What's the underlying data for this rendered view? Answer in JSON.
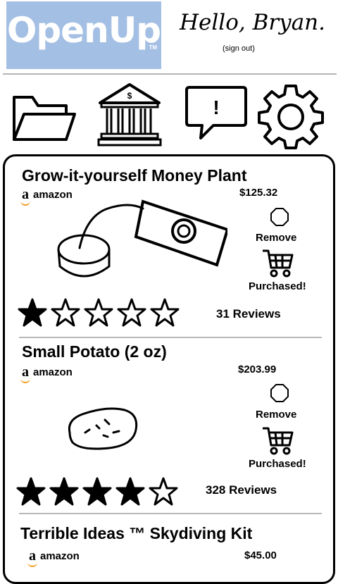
{
  "header": {
    "logo_text": "OpenUp",
    "logo_tm": "TM",
    "greeting": "Hello, Bryan.",
    "sign_out": "(sign out)"
  },
  "nav": {
    "items": [
      {
        "icon": "folder-icon"
      },
      {
        "icon": "bank-icon"
      },
      {
        "icon": "alert-message-icon"
      },
      {
        "icon": "gear-icon"
      }
    ]
  },
  "products": [
    {
      "title": "Grow-it-yourself Money Plant",
      "vendor": "amazon",
      "vendor_logo": "a",
      "price": "$125.32",
      "remove_label": "Remove",
      "purchased_label": "Purchased!",
      "rating": 1,
      "rating_max": 5,
      "reviews": "31 Reviews"
    },
    {
      "title": "Small Potato (2 oz)",
      "vendor": "amazon",
      "vendor_logo": "a",
      "price": "$203.99",
      "remove_label": "Remove",
      "purchased_label": "Purchased!",
      "rating": 4,
      "rating_max": 5,
      "reviews": "328 Reviews"
    },
    {
      "title": "Terrible Ideas ™ Skydiving Kit",
      "vendor": "amazon",
      "vendor_logo": "a",
      "price": "$45.00"
    }
  ]
}
